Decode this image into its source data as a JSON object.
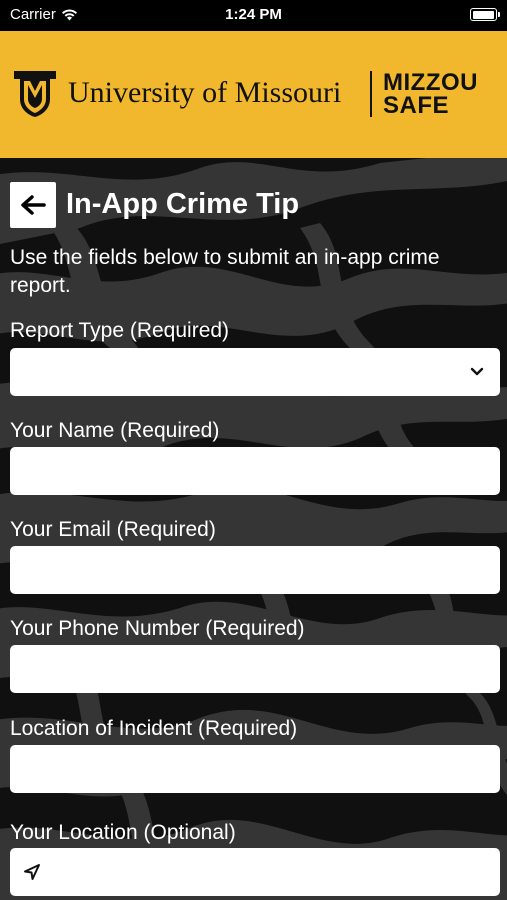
{
  "status_bar": {
    "carrier": "Carrier",
    "time": "1:24 PM",
    "battery_level": 1.0
  },
  "banner": {
    "university_name": "University of Missouri",
    "brand_line1": "MIZZOU",
    "brand_line2": "SAFE",
    "colors": {
      "gold": "#F1B82D",
      "black": "#111111"
    }
  },
  "header": {
    "back_icon": "arrow-left-icon",
    "title": "In-App Crime Tip"
  },
  "intro_text": "Use the fields below to submit an in-app crime report.",
  "form": {
    "report_type": {
      "label": "Report Type (Required)",
      "value": ""
    },
    "name": {
      "label": "Your Name (Required)",
      "value": ""
    },
    "email": {
      "label": "Your Email (Required)",
      "value": ""
    },
    "phone": {
      "label": "Your Phone Number (Required)",
      "value": ""
    },
    "incident_location": {
      "label": "Location of Incident (Required)",
      "value": ""
    },
    "your_location": {
      "label": "Your Location (Optional)",
      "value": "",
      "icon": "location-arrow-icon"
    }
  }
}
